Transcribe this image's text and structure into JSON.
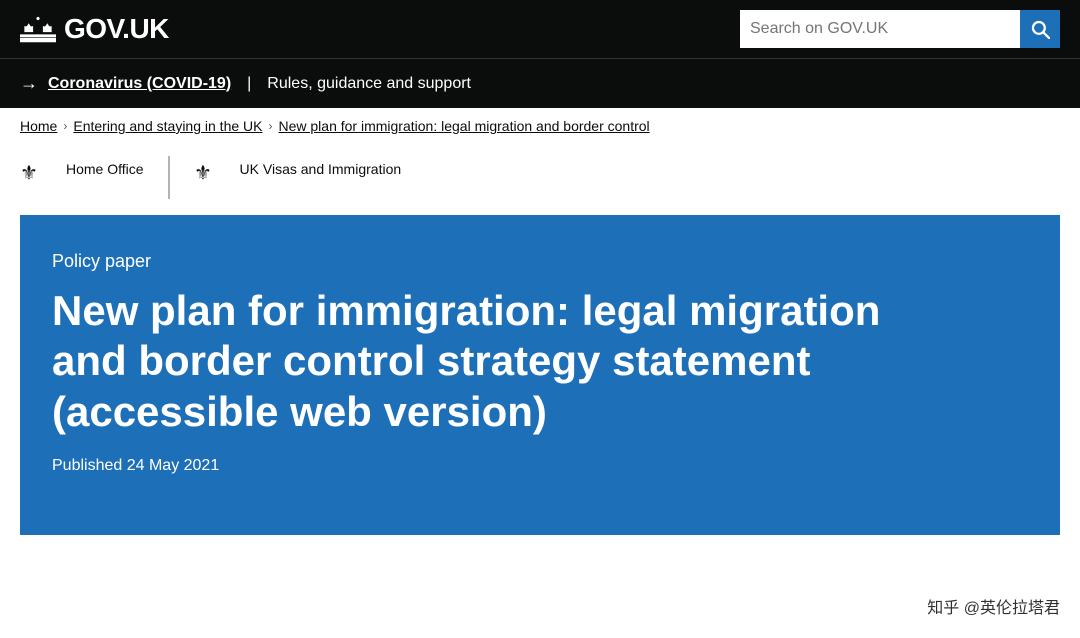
{
  "header": {
    "logo_text": "GOV.UK",
    "search_placeholder": "Search on GOV.UK"
  },
  "covid_banner": {
    "arrow": "→",
    "link_text": "Coronavirus (COVID-19)",
    "separator": "|",
    "support_text": "Rules, guidance and support"
  },
  "breadcrumb": {
    "home": "Home",
    "entering": "Entering and staying in the UK",
    "current": "New plan for immigration: legal migration and border control"
  },
  "publishers": [
    {
      "name": "Home Office"
    },
    {
      "name": "UK Visas and Immigration"
    }
  ],
  "hero": {
    "policy_type": "Policy paper",
    "title": "New plan for immigration: legal migration and border control strategy statement (accessible web version)",
    "published": "Published 24 May 2021"
  },
  "watermark": {
    "text": "知乎 @英伦拉塔君"
  }
}
